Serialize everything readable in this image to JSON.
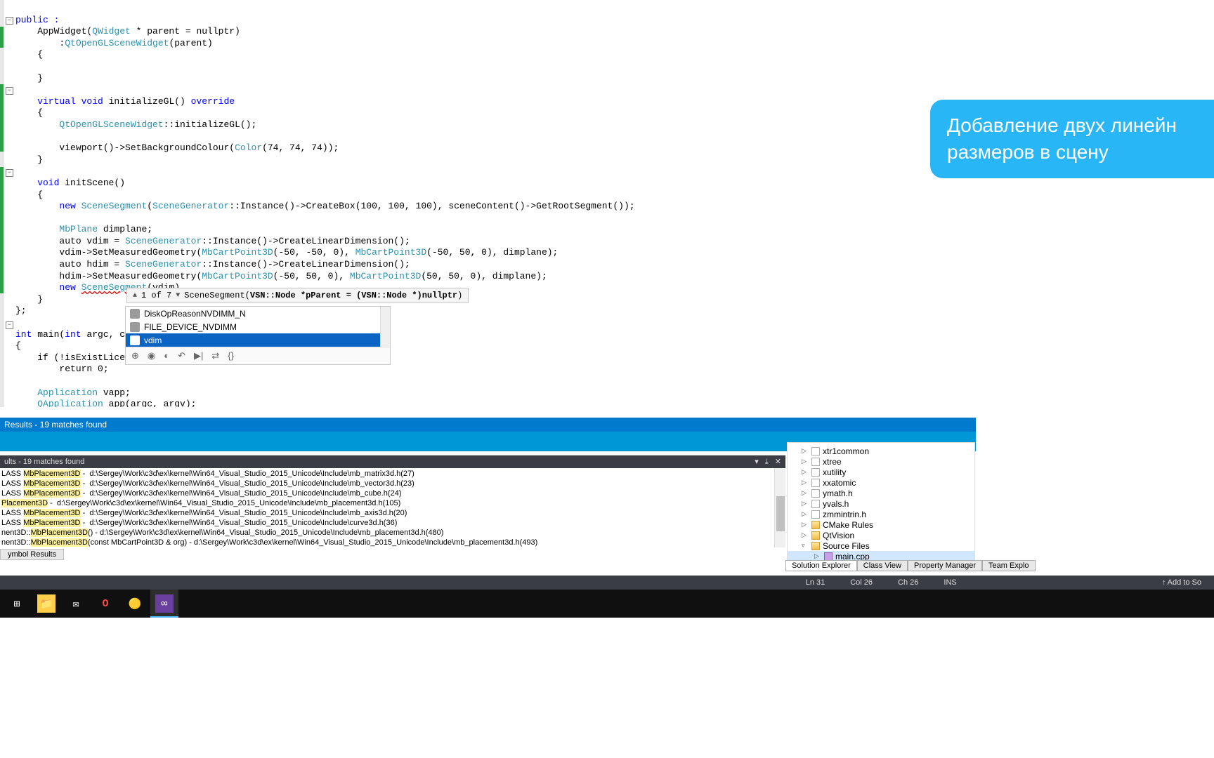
{
  "annotation": "Добавление двух линейн\nразмеров в сцену",
  "code": {
    "l1": "public :",
    "l2a": "    AppWidget(",
    "l2b": "QWidget",
    "l2c": " * parent = nullptr)",
    "l3a": "        :",
    "l3b": "QtOpenGLSceneWidget",
    "l3c": "(parent)",
    "l4": "    {",
    "l5": "",
    "l6": "    }",
    "l7": "",
    "l8a": "    virtual void",
    "l8b": " initializeGL() ",
    "l8c": "override",
    "l9": "    {",
    "l10a": "        ",
    "l10b": "QtOpenGLSceneWidget",
    "l10c": "::initializeGL();",
    "l11": "",
    "l12a": "        viewport()->SetBackgroundColour(",
    "l12b": "Color",
    "l12c": "(74, 74, 74));",
    "l13": "    }",
    "l14": "",
    "l15a": "    void",
    "l15b": " initScene()",
    "l16": "    {",
    "l17a": "        new ",
    "l17b": "SceneSegment",
    "l17c": "(",
    "l17d": "SceneGenerator",
    "l17e": "::Instance()->CreateBox(100, 100, 100), sceneContent()->GetRootSegment());",
    "l18": "",
    "l19a": "        ",
    "l19b": "MbPlane",
    "l19c": " dimplane;",
    "l20a": "        auto vdim = ",
    "l20b": "SceneGenerator",
    "l20c": "::Instance()->CreateLinearDimension();",
    "l21a": "        vdim->SetMeasuredGeometry(",
    "l21b": "MbCartPoint3D",
    "l21c": "(-50, -50, 0), ",
    "l21d": "MbCartPoint3D",
    "l21e": "(-50, 50, 0), dimplane);",
    "l22a": "        auto hdim = ",
    "l22b": "SceneGenerator",
    "l22c": "::Instance()->CreateLinearDimension();",
    "l23a": "        hdim->SetMeasuredGeometry(",
    "l23b": "MbCartPoint3D",
    "l23c": "(-50, 50, 0), ",
    "l23d": "MbCartPoint3D",
    "l23e": "(50, 50, 0), dimplane);",
    "l24a": "        new ",
    "l24b": "SceneSegment",
    "l24c": "(vdim)",
    "l25": "    }",
    "l26": "};",
    "l27": "",
    "l28a": "int",
    "l28b": " main(",
    "l28c": "int",
    "l28d": " argc, ch",
    "l29": "{",
    "l30a": "    if (!isExistLicense",
    "l31": "        return 0;",
    "l32": "",
    "l33a": "    ",
    "l33b": "Application",
    "l33c": " vapp;",
    "l34a": "    ",
    "l34b": "QApplication",
    "l34c": " app(argc, argv);"
  },
  "sig_help": {
    "counter": "1 of 7",
    "text_prefix": "SceneSegment(",
    "text_bold": "VSN::Node *pParent = (VSN::Node *)nullptr",
    "text_suffix": ")"
  },
  "completion": {
    "items": [
      "DiskOpReasonNVDIMM_N",
      "FILE_DEVICE_NVDIMM",
      "vdim"
    ],
    "selected_index": 2,
    "footer_icons": [
      "⊕",
      "◉",
      "◐",
      "↶",
      "▶|",
      "⇄",
      "{}"
    ]
  },
  "symbol_results_header": "Results - 19 matches found",
  "results_panel": {
    "title": "ults - 19 matches found",
    "rows": [
      {
        "pre": "LASS ",
        "hl": "MbPlacement3D",
        "post": " -  d:\\Sergey\\Work\\c3d\\ex\\kernel\\Win64_Visual_Studio_2015_Unicode\\Include\\mb_matrix3d.h(27)"
      },
      {
        "pre": "LASS ",
        "hl": "MbPlacement3D",
        "post": " -  d:\\Sergey\\Work\\c3d\\ex\\kernel\\Win64_Visual_Studio_2015_Unicode\\Include\\mb_vector3d.h(23)"
      },
      {
        "pre": "LASS ",
        "hl": "MbPlacement3D",
        "post": " -  d:\\Sergey\\Work\\c3d\\ex\\kernel\\Win64_Visual_Studio_2015_Unicode\\Include\\mb_cube.h(24)"
      },
      {
        "pre": "",
        "hl": "Placement3D",
        "post": " -  d:\\Sergey\\Work\\c3d\\ex\\kernel\\Win64_Visual_Studio_2015_Unicode\\Include\\mb_placement3d.h(105)"
      },
      {
        "pre": "LASS ",
        "hl": "MbPlacement3D",
        "post": " -  d:\\Sergey\\Work\\c3d\\ex\\kernel\\Win64_Visual_Studio_2015_Unicode\\Include\\mb_axis3d.h(20)"
      },
      {
        "pre": "LASS ",
        "hl": "MbPlacement3D",
        "post": " -  d:\\Sergey\\Work\\c3d\\ex\\kernel\\Win64_Visual_Studio_2015_Unicode\\Include\\curve3d.h(36)"
      },
      {
        "pre": "nent3D::",
        "hl": "MbPlacement3D",
        "post": "() - d:\\Sergey\\Work\\c3d\\ex\\kernel\\Win64_Visual_Studio_2015_Unicode\\Include\\mb_placement3d.h(480)"
      },
      {
        "pre": "nent3D::",
        "hl": "MbPlacement3D",
        "post": "(const MbCartPoint3D & org) - d:\\Sergey\\Work\\c3d\\ex\\kernel\\Win64_Visual_Studio_2015_Unicode\\Include\\mb_placement3d.h(493)"
      }
    ],
    "tab": "ymbol Results"
  },
  "solution_tree": [
    {
      "arrow": "▷",
      "icon": "file",
      "label": "xtr1common"
    },
    {
      "arrow": "▷",
      "icon": "file",
      "label": "xtree"
    },
    {
      "arrow": "▷",
      "icon": "file",
      "label": "xutility"
    },
    {
      "arrow": "▷",
      "icon": "file",
      "label": "xxatomic"
    },
    {
      "arrow": "▷",
      "icon": "file",
      "label": "ymath.h"
    },
    {
      "arrow": "▷",
      "icon": "file",
      "label": "yvals.h"
    },
    {
      "arrow": "▷",
      "icon": "file",
      "label": "zmmintrin.h"
    },
    {
      "arrow": "▷",
      "icon": "fold",
      "label": "CMake Rules"
    },
    {
      "arrow": "▷",
      "icon": "fold",
      "label": "QtVision"
    },
    {
      "arrow": "▿",
      "icon": "fold",
      "label": "Source Files"
    },
    {
      "arrow": "▷",
      "icon": "cpp",
      "label": "main.cpp",
      "sel": true,
      "indent": true
    }
  ],
  "solution_tabs": [
    "Solution Explorer",
    "Class View",
    "Property Manager",
    "Team Explo"
  ],
  "status": {
    "ln": "Ln 31",
    "col": "Col 26",
    "ch": "Ch 26",
    "ins": "INS",
    "right": "↑ Add to So"
  },
  "taskbar_labels": [
    "start-menu",
    "file-explorer",
    "mail",
    "opera",
    "chrome",
    "visual-studio"
  ]
}
